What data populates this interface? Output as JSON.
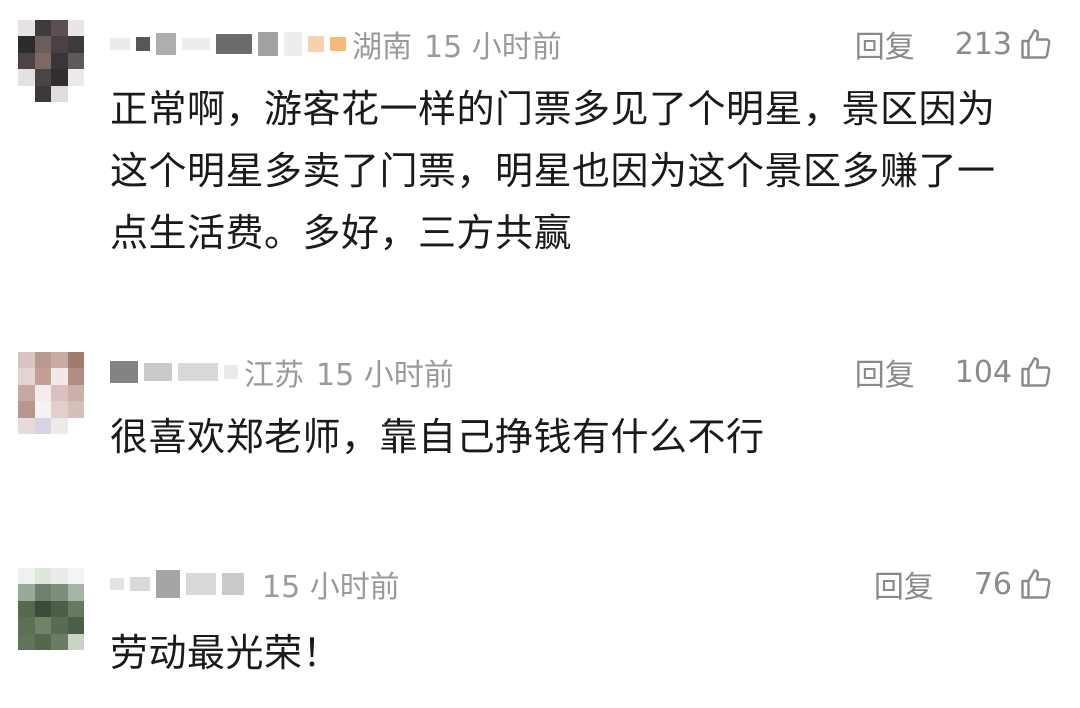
{
  "comments": [
    {
      "location": "湖南",
      "time": "15 小时前",
      "reply_label": "回复",
      "likes": "213",
      "text_lines": [
        "正常啊，游客花一样的门票多见了个明星，景区因为",
        "这个明星多卖了门票，明星也因为这个景区多赚了一",
        "点生活费。多好，三方共赢"
      ]
    },
    {
      "location": "江苏",
      "time": "15 小时前",
      "reply_label": "回复",
      "likes": "104",
      "text_lines": [
        "很喜欢郑老师，靠自己挣钱有什么不行"
      ]
    },
    {
      "location": "",
      "time": "15 小时前",
      "reply_label": "回复",
      "likes": "76",
      "text_lines": [
        "劳动最光荣！"
      ]
    }
  ],
  "colors": {
    "meta_gray": "#9a9a9a",
    "text": "#1a1a1a",
    "background": "#ffffff"
  },
  "icons": {
    "like": "thumbs-up-outline-icon"
  }
}
